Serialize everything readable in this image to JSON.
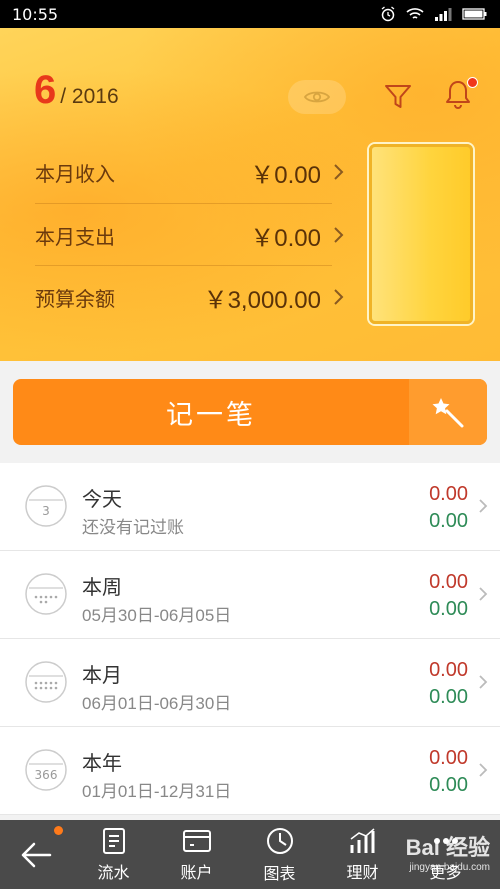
{
  "status_bar": {
    "time": "10:55"
  },
  "header": {
    "month": "6",
    "year": "/ 2016",
    "summary": [
      {
        "label": "本月收入",
        "amount": "￥0.00"
      },
      {
        "label": "本月支出",
        "amount": "￥0.00"
      },
      {
        "label": "预算余额",
        "amount": "￥3,000.00"
      }
    ]
  },
  "record_button": {
    "label": "记一笔"
  },
  "periods": [
    {
      "title": "今天",
      "subtitle": "还没有记过账",
      "icon_text": "3",
      "expense": "0.00",
      "income": "0.00"
    },
    {
      "title": "本周",
      "subtitle": "05月30日-06月05日",
      "icon_text": "",
      "expense": "0.00",
      "income": "0.00"
    },
    {
      "title": "本月",
      "subtitle": "06月01日-06月30日",
      "icon_text": "",
      "expense": "0.00",
      "income": "0.00"
    },
    {
      "title": "本年",
      "subtitle": "01月01日-12月31日",
      "icon_text": "366",
      "expense": "0.00",
      "income": "0.00"
    }
  ],
  "bottom_nav": {
    "items": [
      "流水",
      "账户",
      "图表",
      "理财",
      "更多"
    ]
  },
  "watermark": {
    "main": "Bai 经验",
    "sub": "jingyan.baidu.com"
  },
  "colors": {
    "accent": "#ff8a17",
    "expense": "#c0392b",
    "income": "#2e8b57",
    "month": "#e8381b"
  }
}
